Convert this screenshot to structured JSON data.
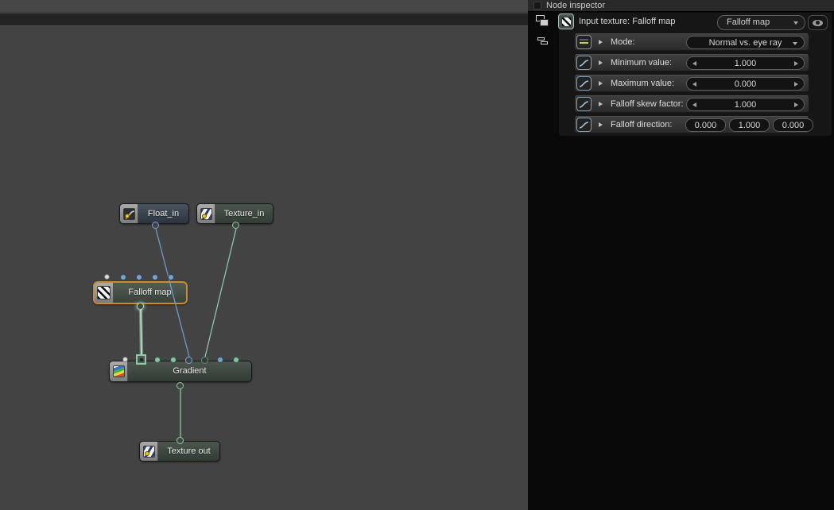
{
  "colors": {
    "canvas_bg": "#434343",
    "panel_bg": "#090909",
    "selection_orange": "#c98c2e",
    "port_blue": "#7aa3cc",
    "port_green": "#8cc7a6",
    "wire_blue": "#6f9ac6",
    "wire_green": "#8cc7a6"
  },
  "panel": {
    "tab_title": "Node inspector",
    "header": {
      "title": "Input texture: Falloff map",
      "preset_dropdown": "Falloff map"
    },
    "rows": [
      {
        "label": "Mode:",
        "value": "Normal vs. eye ray",
        "icon": "enum-icon",
        "control": "dropdown"
      },
      {
        "label": "Minimum value:",
        "value": "1.000",
        "icon": "envelope-curve-icon",
        "control": "stepper"
      },
      {
        "label": "Maximum value:",
        "value": "0.000",
        "icon": "envelope-curve-icon",
        "control": "stepper"
      },
      {
        "label": "Falloff skew factor:",
        "value": "1.000",
        "icon": "envelope-curve-icon",
        "control": "stepper"
      },
      {
        "label": "Falloff direction:",
        "values": [
          "0.000",
          "1.000",
          "0.000"
        ],
        "icon": "envelope-curve-icon",
        "control": "vector3"
      }
    ]
  },
  "graph": {
    "nodes": [
      {
        "label": "Float_in",
        "icon": "channel-curve-icon",
        "selected": false
      },
      {
        "label": "Texture_in",
        "icon": "texture-icon",
        "selected": false
      },
      {
        "label": "Falloff map",
        "icon": "hatch-texture-icon",
        "selected": true
      },
      {
        "label": "Gradient",
        "icon": "gradient-icon",
        "selected": false
      },
      {
        "label": "Texture out",
        "icon": "texture-icon",
        "selected": false
      }
    ]
  }
}
